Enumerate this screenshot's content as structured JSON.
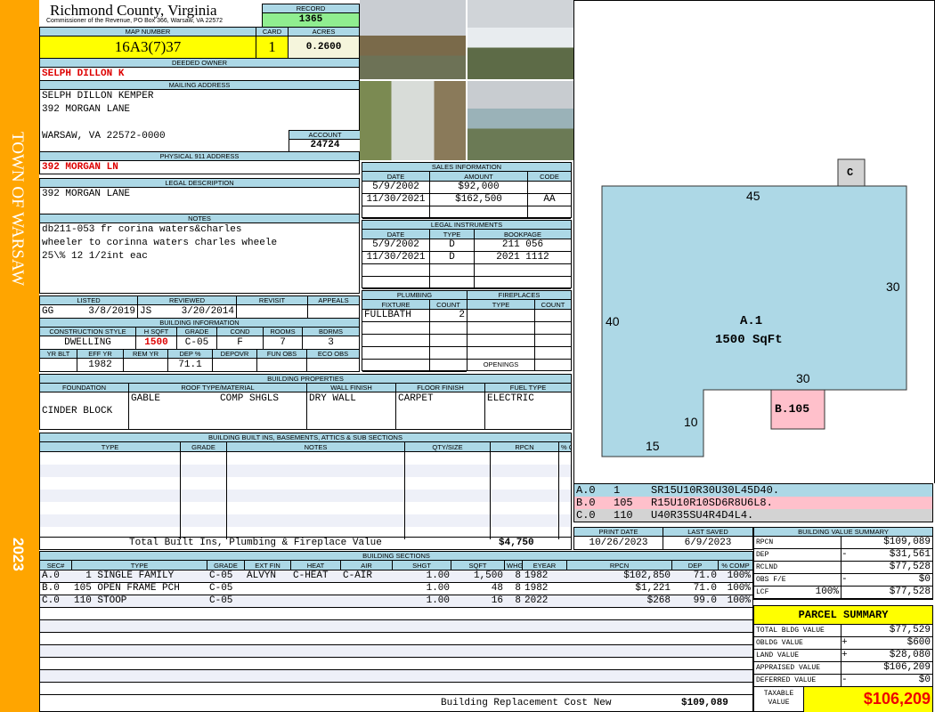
{
  "sidebar": {
    "town": "TOWN OF WARSAW",
    "year": "2023",
    "color": "#ffa500"
  },
  "header": {
    "title": "Richmond County, Virginia",
    "subtitle": "Commissioner of the Revenue, PO Box 366, Warsaw, VA 22572",
    "record_label": "RECORD",
    "record": "1365"
  },
  "parcel": {
    "map_label": "MAP NUMBER",
    "map": "16A3(7)37",
    "card_label": "CARD",
    "card": "1",
    "acres_label": "ACRES",
    "acres": "0.2600"
  },
  "owner": {
    "label": "DEEDED OWNER",
    "name": "SELPH DILLON K"
  },
  "mailing": {
    "label": "MAILING ADDRESS",
    "line1": "SELPH DILLON KEMPER",
    "line2": "392 MORGAN LANE",
    "line3": "WARSAW, VA 22572-0000",
    "account_label": "ACCOUNT",
    "account": "24724"
  },
  "physical": {
    "label": "PHYSICAL 911 ADDRESS",
    "value": "392 MORGAN LN"
  },
  "legal": {
    "label": "LEGAL DESCRIPTION",
    "value": "392 MORGAN LANE"
  },
  "notes": {
    "label": "NOTES",
    "lines": [
      "db211-053 fr corina waters&charles",
      "wheeler to corinna waters charles wheele",
      "25\\% 12 1/2int eac"
    ]
  },
  "review": {
    "headers": [
      "LISTED",
      "REVIEWED",
      "REVISIT",
      "APPEALS"
    ],
    "listed_by": "GG",
    "listed": "3/8/2019",
    "reviewed_by": "JS",
    "reviewed": "3/20/2014"
  },
  "building_info": {
    "label": "BUILDING INFORMATION",
    "headers1": [
      "CONSTRUCTION STYLE",
      "H SQFT",
      "GRADE",
      "COND",
      "ROOMS",
      "BDRMS"
    ],
    "values1": [
      "DWELLING",
      "1500",
      "C-05",
      "F",
      "7",
      "3"
    ],
    "headers2": [
      "YR BLT",
      "EFF YR",
      "REM YR",
      "DEP %",
      "DEPOVR",
      "FUN OBS",
      "ECO OBS"
    ],
    "values2": [
      "",
      "1982",
      "",
      "71.1",
      "",
      "",
      ""
    ]
  },
  "properties": {
    "label": "BUILDING PROPERTIES",
    "headers": [
      "FOUNDATION",
      "ROOF TYPE/MATERIAL",
      "WALL FINISH",
      "FLOOR FINISH",
      "FUEL TYPE"
    ],
    "foundation": "CINDER BLOCK",
    "roof_type": "GABLE",
    "roof_material": "COMP SHGLS",
    "wall": "DRY WALL",
    "floor": "CARPET",
    "fuel": "ELECTRIC"
  },
  "builtins": {
    "label": "BUILDING BUILT INS, BASEMENTS, ATTICS & SUB SECTIONS",
    "headers": [
      "TYPE",
      "GRADE",
      "NOTES",
      "QTY/SIZE",
      "RPCN",
      "% COMP"
    ],
    "total_label": "Total Built Ins, Plumbing & Fireplace Value",
    "total": "$4,750"
  },
  "sales": {
    "label": "SALES INFORMATION",
    "headers": [
      "DATE",
      "AMOUNT",
      "CODE"
    ],
    "rows": [
      [
        "5/9/2002",
        "$92,000",
        ""
      ],
      [
        "11/30/2021",
        "$162,500",
        "AA"
      ]
    ]
  },
  "instruments": {
    "label": "LEGAL INSTRUMENTS",
    "headers": [
      "DATE",
      "TYPE",
      "BOOKPAGE"
    ],
    "rows": [
      [
        "5/9/2002",
        "D",
        "211 056"
      ],
      [
        "11/30/2021",
        "D",
        "2021 1112"
      ]
    ]
  },
  "plumbing": {
    "label": "PLUMBING",
    "headers": [
      "FIXTURE",
      "COUNT"
    ],
    "rows": [
      [
        "FULLBATH",
        "2"
      ]
    ]
  },
  "fireplaces": {
    "label": "FIREPLACES",
    "headers": [
      "TYPE",
      "COUNT"
    ],
    "openings_label": "OPENINGS"
  },
  "sketch": {
    "main_label": "A.1",
    "main_area": "1500 SqFt",
    "dims": {
      "top": "45",
      "right": "30",
      "left": "40",
      "inner": "30",
      "step": "10",
      "bottom": "15"
    },
    "porch": "B.105",
    "stoop": "C",
    "legend": [
      {
        "sec": "A.0",
        "code": "1",
        "path": "SR15U10R30U30L45D40.",
        "color": "#add8e6"
      },
      {
        "sec": "B.0",
        "code": "105",
        "path": "R15U10R10SD6R8U6L8.",
        "color": "#ffc0cb"
      },
      {
        "sec": "C.0",
        "code": "110",
        "path": "U40R35SU4R4D4L4.",
        "color": "#d3d3d3"
      }
    ]
  },
  "dates": {
    "print_label": "PRINT DATE",
    "print": "10/26/2023",
    "saved_label": "LAST SAVED",
    "saved": "6/9/2023"
  },
  "sections": {
    "label": "BUILDING SECTIONS",
    "headers": [
      "SEC#",
      "TYPE",
      "GRADE",
      "EXT FIN",
      "HEAT",
      "AIR",
      "SHGT",
      "SQFT",
      "WHGT",
      "EYEAR",
      "RPCN",
      "DEP",
      "% COMP"
    ],
    "rows": [
      [
        "A.0",
        "  1 SINGLE FAMILY",
        "C-05",
        "ALVYN",
        "C-HEAT",
        "C-AIR",
        "1.00",
        "1,500",
        "8",
        "1982",
        "$102,850",
        "71.0",
        "100%"
      ],
      [
        "B.0",
        "105 OPEN FRAME PCH",
        "C-05",
        "",
        "",
        "",
        "1.00",
        "48",
        "8",
        "1982",
        "$1,221",
        "71.0",
        "100%"
      ],
      [
        "C.0",
        "110 STOOP",
        "C-05",
        "",
        "",
        "",
        "1.00",
        "16",
        "8",
        "2022",
        "$268",
        "99.0",
        "100%"
      ]
    ],
    "total_label": "Building Replacement Cost New",
    "total": "$109,089"
  },
  "value_summary": {
    "label": "BUILDING VALUE SUMMARY",
    "rows": [
      {
        "k": "RPCN",
        "op": "",
        "v": "$109,089"
      },
      {
        "k": "DEP",
        "op": "-",
        "v": "$31,561"
      },
      {
        "k": "RCLND",
        "op": "",
        "v": "$77,528"
      },
      {
        "k": "OBS F/E",
        "op": "-",
        "v": "$0"
      },
      {
        "k": "LCF",
        "pct": "100%",
        "op": "",
        "v": "$77,528"
      }
    ]
  },
  "parcel_summary": {
    "label": "PARCEL SUMMARY",
    "rows": [
      {
        "k": "TOTAL BLDG VALUE",
        "op": "",
        "v": "$77,529"
      },
      {
        "k": "OBLDG VALUE",
        "op": "+",
        "v": "$600"
      },
      {
        "k": "LAND VALUE",
        "op": "+",
        "v": "$28,080"
      },
      {
        "k": "APPRAISED VALUE",
        "op": "",
        "v": "$106,209"
      },
      {
        "k": "DEFERRED VALUE",
        "op": "-",
        "v": "$0"
      }
    ],
    "taxable_label": "TAXABLE VALUE",
    "taxable": "$106,209"
  }
}
